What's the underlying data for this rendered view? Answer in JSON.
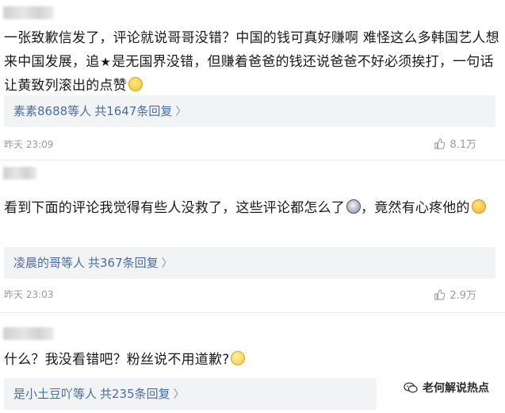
{
  "comments": [
    {
      "text_a": "一张致歉信发了，评论就说哥哥没错？中国的钱可真好赚啊 难怪这么多韩国艺人想来中国发展，追",
      "text_b": "是无国界没错，但赚着爸爸的钱还说爸爸不好必须挨打，一句话让黄致列滚出的点赞",
      "reply_users": "素素8688等人",
      "reply_count": "共1647条回复",
      "time": "昨天 23:09",
      "likes": "8.1万"
    },
    {
      "text_a": "看到下面的评论我觉得有些人没救了，这些评论都怎么了",
      "text_b": "，竟然有心疼他的",
      "reply_users": "凌晨的哥等人",
      "reply_count": "共367条回复",
      "time": "昨天 23:03",
      "likes": "2.9万"
    },
    {
      "text_a": "什么？我没看错吧？粉丝说不用道歉?",
      "reply_users": "是小土豆吖等人",
      "reply_count": "共235条回复"
    }
  ],
  "watermark": {
    "text": "老何解说热点"
  },
  "icons": {
    "reply_chevron": "chevron-right-icon",
    "like": "thumb-up-icon",
    "star": "star-icon",
    "wechat": "wechat-icon"
  },
  "colors": {
    "link_blue": "#4a6ea0",
    "reply_bg": "#f2f3f5",
    "meta_gray": "#9a9a9a"
  }
}
